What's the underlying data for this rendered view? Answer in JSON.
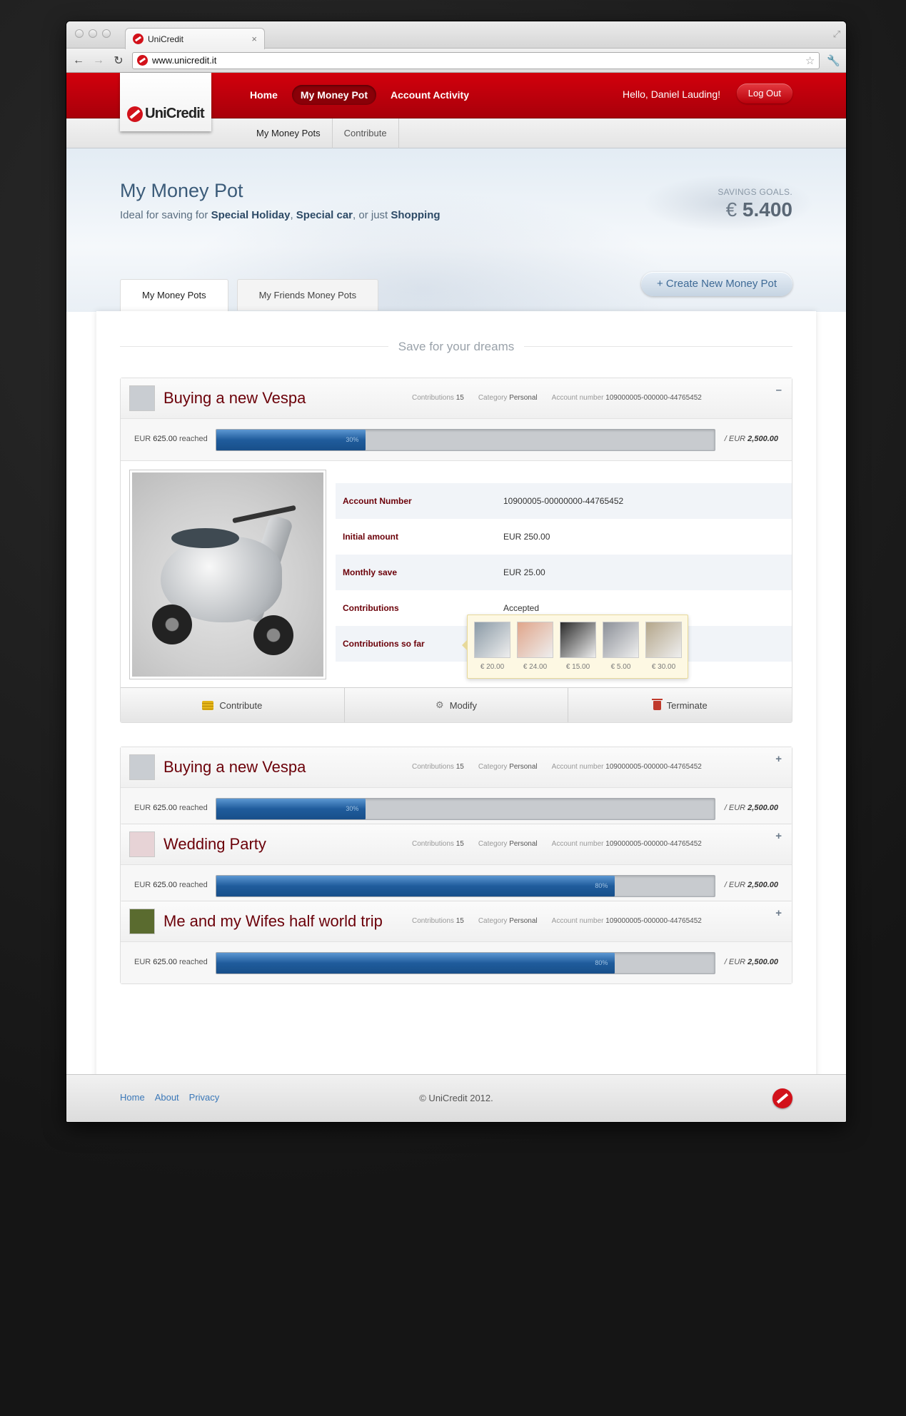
{
  "browser": {
    "tab_title": "UniCredit",
    "url": "www.unicredit.it"
  },
  "header": {
    "logo_text": "UniCredit",
    "nav": [
      {
        "label": "Home",
        "active": false
      },
      {
        "label": "My Money Pot",
        "active": true
      },
      {
        "label": "Account Activity",
        "active": false
      }
    ],
    "greeting": "Hello,  Daniel Lauding!",
    "logout_label": "Log Out"
  },
  "subnav": [
    "My Money Pots",
    "Contribute"
  ],
  "hero": {
    "title": "My Money Pot",
    "subtitle_prefix": "Ideal for saving for ",
    "subtitle_item1": "Special Holiday",
    "subtitle_sep1": ", ",
    "subtitle_item2": "Special car",
    "subtitle_sep2": ", or just ",
    "subtitle_item3": "Shopping",
    "savings_label": "SAVINGS GOALS.",
    "savings_currency": "€",
    "savings_amount": "5.400",
    "tabs": [
      "My Money Pots",
      "My Friends Money Pots"
    ],
    "create_button": "+ Create New Money Pot"
  },
  "section_title": "Save for your dreams",
  "meta_labels": {
    "contributions": "Contributions",
    "category": "Category",
    "account": "Account number"
  },
  "pots": [
    {
      "title": "Buying a new Vespa",
      "contributions": "15",
      "category": "Personal",
      "account": "109000005-000000-44765452",
      "reached_currency": "EUR",
      "reached_amount": "625.00",
      "reached_word": "reached",
      "percent": 30,
      "percent_label": "30%",
      "target_prefix": "/ EUR",
      "target_amount": "2,500.00",
      "toggle": "–",
      "expanded": true,
      "thumb_color": "#c9cdd2"
    },
    {
      "title": "Buying a new Vespa",
      "contributions": "15",
      "category": "Personal",
      "account": "109000005-000000-44765452",
      "reached_currency": "EUR",
      "reached_amount": "625.00",
      "reached_word": "reached",
      "percent": 30,
      "percent_label": "30%",
      "target_prefix": "/ EUR",
      "target_amount": "2,500.00",
      "toggle": "+",
      "expanded": false,
      "thumb_color": "#c9cdd2"
    },
    {
      "title": "Wedding Party",
      "contributions": "15",
      "category": "Personal",
      "account": "109000005-000000-44765452",
      "reached_currency": "EUR",
      "reached_amount": "625.00",
      "reached_word": "reached",
      "percent": 80,
      "percent_label": "80%",
      "target_prefix": "/ EUR",
      "target_amount": "2,500.00",
      "toggle": "+",
      "expanded": false,
      "thumb_color": "#e7d3d6"
    },
    {
      "title": "Me and my Wifes half world trip",
      "contributions": "15",
      "category": "Personal",
      "account": "109000005-000000-44765452",
      "reached_currency": "EUR",
      "reached_amount": "625.00",
      "reached_word": "reached",
      "percent": 80,
      "percent_label": "80%",
      "target_prefix": "/ EUR",
      "target_amount": "2,500.00",
      "toggle": "+",
      "expanded": false,
      "thumb_color": "#5a6b2f"
    }
  ],
  "details": [
    {
      "key": "Account Number",
      "value": "10900005-00000000-44765452"
    },
    {
      "key": "Initial amount",
      "value": "EUR 250.00"
    },
    {
      "key": "Monthly save",
      "value": "EUR 25.00"
    },
    {
      "key": "Contributions",
      "value": "Accepted"
    },
    {
      "key": "Contributions so far",
      "value": ""
    }
  ],
  "contributors": [
    {
      "amount": "€ 20.00",
      "color": "#8a9aa6"
    },
    {
      "amount": "€ 24.00",
      "color": "#e0a58a"
    },
    {
      "amount": "€ 15.00",
      "color": "#2b2b2b"
    },
    {
      "amount": "€ 5.00",
      "color": "#8c9098"
    },
    {
      "amount": "€ 30.00",
      "color": "#b4a68a"
    }
  ],
  "actions": [
    "Contribute",
    "Modify",
    "Terminate"
  ],
  "footer": {
    "links": [
      "Home",
      "About",
      "Privacy"
    ],
    "copyright": "© UniCredit 2012."
  },
  "colors": {
    "brand_red": "#d2000d",
    "title_red": "#6b0009",
    "progress_blue": "#1f5c9c",
    "link_blue": "#3b78b8"
  }
}
